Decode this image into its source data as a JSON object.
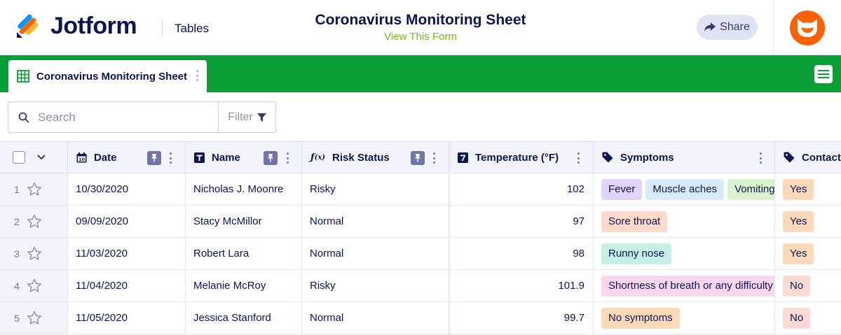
{
  "app": {
    "logo_text": "Jotform",
    "section": "Tables",
    "title": "Coronavirus Monitoring Sheet",
    "view_form": "View This Form",
    "share_label": "Share"
  },
  "tab": {
    "label": "Coronavirus Monitoring Sheet"
  },
  "search": {
    "placeholder": "Search",
    "filter_label": "Filter"
  },
  "columns": {
    "date": "Date",
    "name": "Name",
    "risk": "Risk Status",
    "temp": "Temperature (°F)",
    "symptoms": "Symptoms",
    "contact": "Contact"
  },
  "rows": [
    {
      "num": "1",
      "date": "10/30/2020",
      "name": "Nicholas J. Moonre",
      "risk": "Risky",
      "temp": "102",
      "symptoms": [
        {
          "text": "Fever",
          "color": "#e1d4fb"
        },
        {
          "text": "Muscle aches",
          "color": "#d6ecfb"
        },
        {
          "text": "Vomiting",
          "color": "#d9f3cf"
        }
      ],
      "contact": "Yes"
    },
    {
      "num": "2",
      "date": "09/09/2020",
      "name": "Stacy McMillor",
      "risk": "Normal",
      "temp": "97",
      "symptoms": [
        {
          "text": "Sore throat",
          "color": "#ffd9c9"
        }
      ],
      "contact": "Yes"
    },
    {
      "num": "3",
      "date": "11/03/2020",
      "name": "Robert Lara",
      "risk": "Normal",
      "temp": "98",
      "symptoms": [
        {
          "text": "Runny nose",
          "color": "#c8efe6"
        }
      ],
      "contact": "Yes"
    },
    {
      "num": "4",
      "date": "11/04/2020",
      "name": "Melanie McRoy",
      "risk": "Risky",
      "temp": "101.9",
      "symptoms": [
        {
          "text": "Shortness of breath or any difficulty breathing",
          "color": "#fbd6ee"
        }
      ],
      "contact": "No"
    },
    {
      "num": "5",
      "date": "11/05/2020",
      "name": "Jessica Stanford",
      "risk": "Normal",
      "temp": "99.7",
      "symptoms": [
        {
          "text": "No symptoms",
          "color": "#fcd9b8"
        }
      ],
      "contact": "No"
    }
  ],
  "colors": {
    "brand_green": "#0a9f35",
    "navy": "#0a1551",
    "link_green": "#78b917",
    "avatar_orange": "#ff6100",
    "contact_yes": "#fcd9b8",
    "contact_no": "#fdd9d3"
  },
  "icons": {
    "logo": "jotform-logo-icon",
    "share": "share-arrow-icon",
    "avatar": "cat-avatar-icon",
    "tab": "table-grid-icon",
    "menu": "hamburger-menu-icon",
    "search": "search-icon",
    "filter": "filter-funnel-icon"
  }
}
